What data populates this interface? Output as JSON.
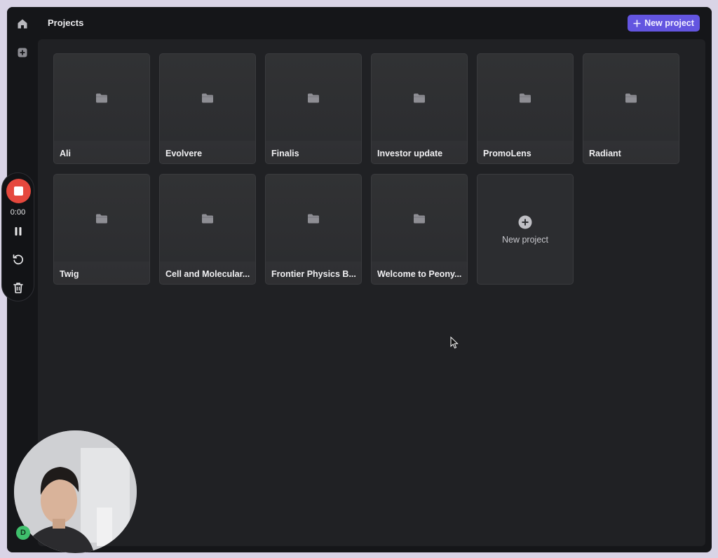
{
  "header": {
    "title": "Projects",
    "new_project_label": "New project"
  },
  "projects": [
    {
      "name": "Ali"
    },
    {
      "name": "Evolvere"
    },
    {
      "name": "Finalis"
    },
    {
      "name": "Investor update"
    },
    {
      "name": "PromoLens"
    },
    {
      "name": "Radiant"
    },
    {
      "name": "Twig"
    },
    {
      "name": "Cell and Molecular..."
    },
    {
      "name": "Frontier Physics B..."
    },
    {
      "name": "Welcome to Peony..."
    }
  ],
  "new_project_card": {
    "label": "New project"
  },
  "recorder": {
    "elapsed": "0:00"
  },
  "user": {
    "avatar_initial": "D"
  },
  "colors": {
    "accent": "#6355e0",
    "record": "#e5483d",
    "background": "#202124",
    "avatar": "#3fbf6c"
  },
  "icons": [
    "home-icon",
    "add-square-icon",
    "plus-icon",
    "folder-icon",
    "plus-circle-icon",
    "stop-icon",
    "pause-icon",
    "restart-icon",
    "trash-icon"
  ]
}
